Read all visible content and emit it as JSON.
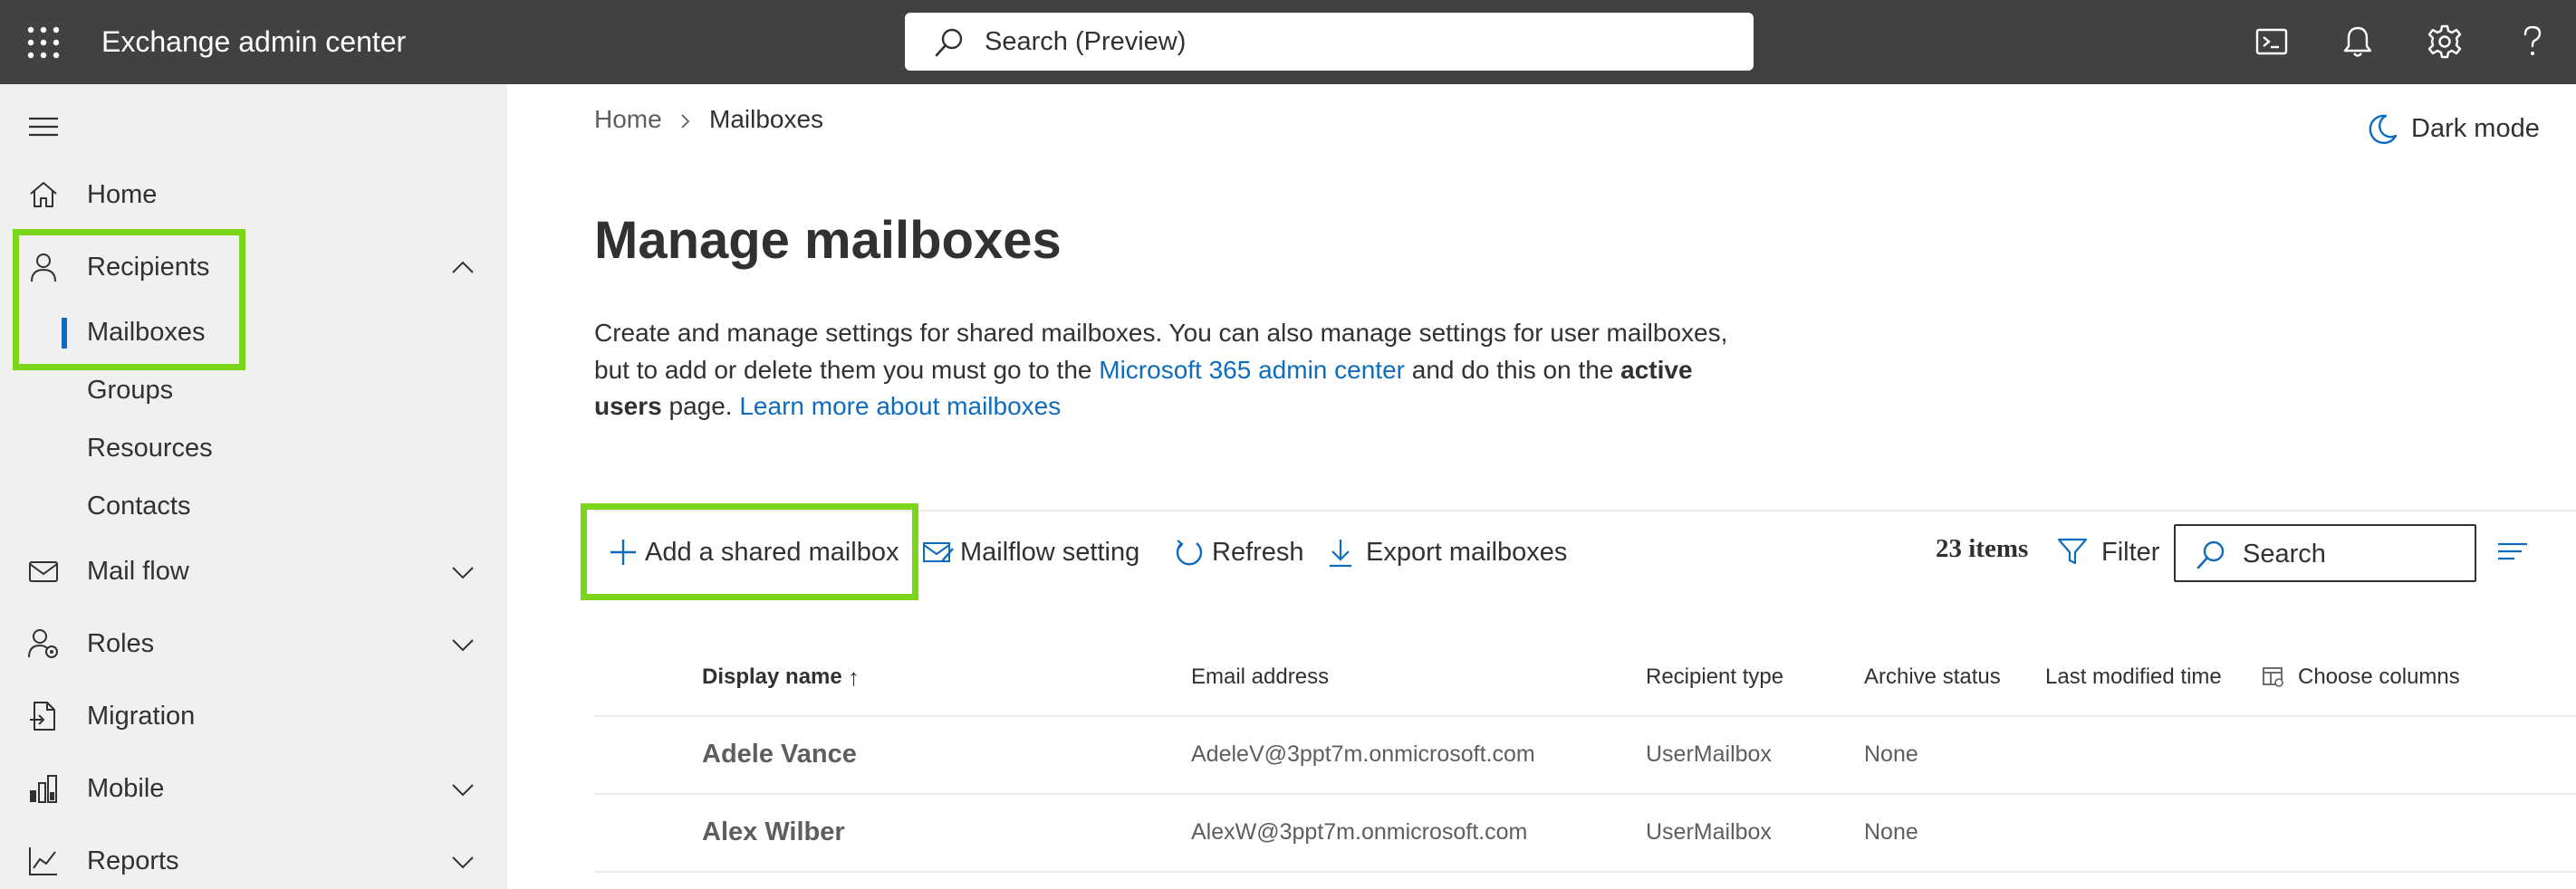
{
  "app": {
    "title": "Exchange admin center"
  },
  "top_search": {
    "placeholder": "Search (Preview)"
  },
  "top_icons": [
    "cloud-shell-icon",
    "bell-icon",
    "gear-icon",
    "help-icon"
  ],
  "sidebar": {
    "items": [
      {
        "label": "Home",
        "icon": "home-icon"
      },
      {
        "label": "Recipients",
        "icon": "person-icon",
        "expanded": true
      },
      {
        "label": "Mailboxes",
        "sub": true,
        "selected": true
      },
      {
        "label": "Groups",
        "sub": true
      },
      {
        "label": "Resources",
        "sub": true
      },
      {
        "label": "Contacts",
        "sub": true
      },
      {
        "label": "Mail flow",
        "icon": "mail-icon"
      },
      {
        "label": "Roles",
        "icon": "roles-icon"
      },
      {
        "label": "Migration",
        "icon": "migration-icon"
      },
      {
        "label": "Mobile",
        "icon": "mobile-icon"
      },
      {
        "label": "Reports",
        "icon": "reports-icon"
      }
    ]
  },
  "breadcrumb": {
    "home": "Home",
    "current": "Mailboxes"
  },
  "dark_mode": {
    "label": "Dark mode"
  },
  "page": {
    "title": "Manage mailboxes",
    "desc_1": "Create and manage settings for shared mailboxes. You can also manage settings for user mailboxes, but to add or delete them you must go to the ",
    "desc_link_1": "Microsoft 365 admin center",
    "desc_2": " and do this on the ",
    "desc_bold": "active users",
    "desc_3": " page. ",
    "desc_link_2": "Learn more about mailboxes"
  },
  "toolbar": {
    "add_shared": "Add a shared mailbox",
    "mailflow": "Mailflow setting",
    "refresh": "Refresh",
    "export": "Export mailboxes",
    "items_count": "23 items",
    "filter": "Filter",
    "search_placeholder": "Search"
  },
  "table": {
    "columns": [
      "Display name",
      "Email address",
      "Recipient type",
      "Archive status",
      "Last modified time",
      "Choose columns"
    ],
    "sort_indicator": "↑",
    "rows": [
      {
        "name": "Adele Vance",
        "email": "AdeleV@3ppt7m.onmicrosoft.com",
        "type": "UserMailbox",
        "archive": "None",
        "modified": ""
      },
      {
        "name": "Alex Wilber",
        "email": "AlexW@3ppt7m.onmicrosoft.com",
        "type": "UserMailbox",
        "archive": "None",
        "modified": ""
      }
    ]
  },
  "colors": {
    "topbar": "#414141",
    "sidebar": "#f0f0f0",
    "accent": "#0f6cbd",
    "highlight": "#7bd51a",
    "link": "#0f6cbd"
  }
}
